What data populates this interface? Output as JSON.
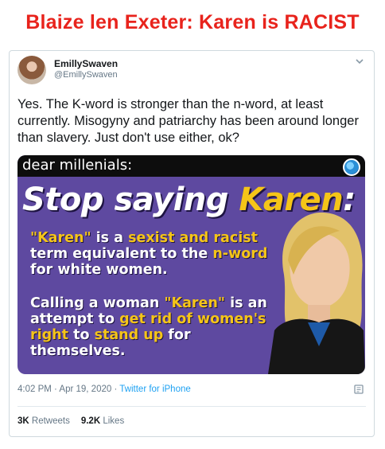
{
  "headline": "Blaize len Exeter: Karen is RACIST",
  "tweet": {
    "display_name": "EmillySwaven",
    "handle": "@EmillySwaven",
    "text": "Yes. The K-word is stronger than the n-word, at least currently. Misogyny and patriarchy has been around longer than slavery. Just don't use either, ok?",
    "timestamp": "4:02 PM · Apr 19, 2020 · ",
    "source": "Twitter for iPhone",
    "retweets_count": "3K",
    "retweets_label": "Retweets",
    "likes_count": "9.2K",
    "likes_label": "Likes"
  },
  "media": {
    "topbar": "dear millenials:",
    "title_a": "Stop saying ",
    "title_b": "Karen",
    "title_c": ":",
    "p1_a": "\"Karen\"",
    "p1_b": " is a ",
    "p1_c": "sexist and racist",
    "p1_d": " term equivalent to the ",
    "p1_e": "n-word",
    "p1_f": " for white women.",
    "p2_a": "Calling a woman ",
    "p2_b": "\"Karen\"",
    "p2_c": " is an attempt to ",
    "p2_d": "get rid of women's right",
    "p2_e": " to ",
    "p2_f": "stand up",
    "p2_g": " for themselves."
  },
  "colors": {
    "headline_red": "#e8231c",
    "media_purple": "#5e49a0",
    "accent_yellow": "#f5c518",
    "link_blue": "#1da1f2"
  },
  "icons": [
    "chevron-down-icon",
    "globe-icon",
    "share-icon",
    "down-arrow-annotation"
  ]
}
